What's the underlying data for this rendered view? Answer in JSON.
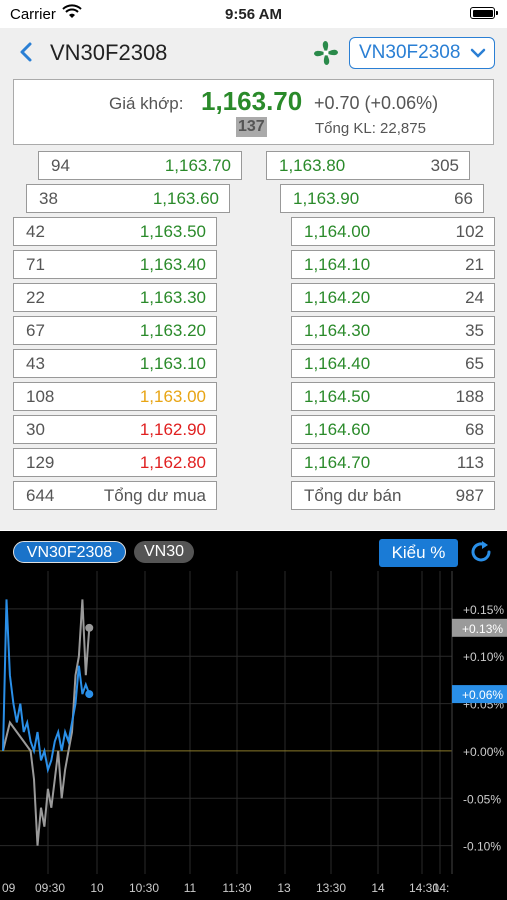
{
  "status": {
    "carrier": "Carrier",
    "time": "9:56 AM"
  },
  "header": {
    "title": "VN30F2308",
    "selected_symbol": "VN30F2308"
  },
  "price": {
    "label": "Giá khớp:",
    "value": "1,163.70",
    "change": "+0.70 (+0.06%)",
    "volume": "137",
    "total_volume": "Tổng KL: 22,875"
  },
  "orderbook": {
    "bids": [
      {
        "qty": "94",
        "price": "1,163.70",
        "color": "#2a8a2a"
      },
      {
        "qty": "38",
        "price": "1,163.60",
        "color": "#2a8a2a"
      },
      {
        "qty": "42",
        "price": "1,163.50",
        "color": "#2a8a2a"
      },
      {
        "qty": "71",
        "price": "1,163.40",
        "color": "#2a8a2a"
      },
      {
        "qty": "22",
        "price": "1,163.30",
        "color": "#2a8a2a"
      },
      {
        "qty": "67",
        "price": "1,163.20",
        "color": "#2a8a2a"
      },
      {
        "qty": "43",
        "price": "1,163.10",
        "color": "#2a8a2a"
      },
      {
        "qty": "108",
        "price": "1,163.00",
        "color": "#e8a515"
      },
      {
        "qty": "30",
        "price": "1,162.90",
        "color": "#e02020"
      },
      {
        "qty": "129",
        "price": "1,162.80",
        "color": "#e02020"
      }
    ],
    "asks": [
      {
        "price": "1,163.80",
        "qty": "305"
      },
      {
        "price": "1,163.90",
        "qty": "66"
      },
      {
        "price": "1,164.00",
        "qty": "102"
      },
      {
        "price": "1,164.10",
        "qty": "21"
      },
      {
        "price": "1,164.20",
        "qty": "24"
      },
      {
        "price": "1,164.30",
        "qty": "35"
      },
      {
        "price": "1,164.40",
        "qty": "65"
      },
      {
        "price": "1,164.50",
        "qty": "188"
      },
      {
        "price": "1,164.60",
        "qty": "68"
      },
      {
        "price": "1,164.70",
        "qty": "113"
      }
    ],
    "total_bid": {
      "qty": "644",
      "label": "Tổng dư mua"
    },
    "total_ask": {
      "label": "Tổng dư bán",
      "qty": "987"
    }
  },
  "chart_tabs": {
    "active": "VN30F2308",
    "inactive": "VN30",
    "style_button": "Kiểu %"
  },
  "chart_data": {
    "type": "line",
    "y_unit": "%",
    "y_ticks": [
      "+0.15%",
      "+0.13%",
      "+0.10%",
      "+0.06%",
      "+0.05%",
      "+0.00%",
      "-0.05%",
      "-0.10%"
    ],
    "x_ticks": [
      "09",
      "09:30",
      "10",
      "10:30",
      "11",
      "11:30",
      "13",
      "13:30",
      "14",
      "14:30",
      "14:"
    ],
    "ylim": [
      -0.13,
      0.19
    ],
    "series": [
      {
        "name": "VN30F2308",
        "color": "#2a8fe8",
        "last_label": "+0.06%",
        "points": [
          [
            0,
            0.0
          ],
          [
            1,
            0.16
          ],
          [
            2,
            0.08
          ],
          [
            3,
            0.05
          ],
          [
            4,
            0.03
          ],
          [
            5,
            0.05
          ],
          [
            6,
            0.02
          ],
          [
            7,
            0.03
          ],
          [
            8,
            0.01
          ],
          [
            9,
            0.0
          ],
          [
            10,
            0.02
          ],
          [
            11,
            -0.01
          ],
          [
            12,
            0.0
          ],
          [
            13,
            -0.02
          ],
          [
            14,
            -0.01
          ],
          [
            15,
            0.01
          ],
          [
            16,
            0.02
          ],
          [
            17,
            0.0
          ],
          [
            18,
            0.02
          ],
          [
            19,
            0.01
          ],
          [
            20,
            0.03
          ],
          [
            21,
            0.05
          ],
          [
            22,
            0.09
          ],
          [
            23,
            0.06
          ],
          [
            24,
            0.07
          ],
          [
            25,
            0.06
          ]
        ]
      },
      {
        "name": "VN30",
        "color": "#9a9a9a",
        "last_label": "+0.13%",
        "points": [
          [
            0,
            0.0
          ],
          [
            2,
            0.03
          ],
          [
            4,
            0.02
          ],
          [
            6,
            0.01
          ],
          [
            8,
            0.0
          ],
          [
            9,
            -0.03
          ],
          [
            10,
            -0.1
          ],
          [
            11,
            -0.06
          ],
          [
            12,
            -0.08
          ],
          [
            13,
            -0.04
          ],
          [
            14,
            -0.06
          ],
          [
            15,
            -0.03
          ],
          [
            16,
            0.0
          ],
          [
            17,
            -0.05
          ],
          [
            18,
            -0.02
          ],
          [
            19,
            0.0
          ],
          [
            20,
            0.02
          ],
          [
            21,
            0.08
          ],
          [
            22,
            0.1
          ],
          [
            23,
            0.16
          ],
          [
            24,
            0.08
          ],
          [
            25,
            0.13
          ]
        ]
      }
    ]
  }
}
